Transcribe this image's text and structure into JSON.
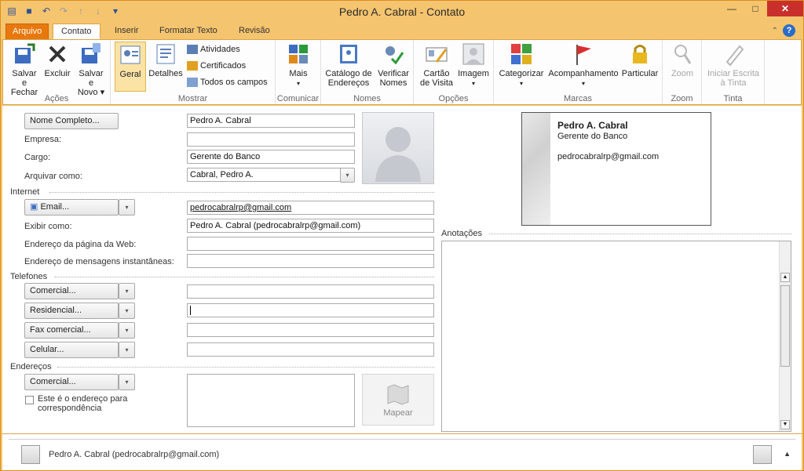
{
  "window": {
    "title": "Pedro A. Cabral  -  Contato"
  },
  "tabs": {
    "file": "Arquivo",
    "contact": "Contato",
    "insert": "Inserir",
    "format": "Formatar Texto",
    "review": "Revisão"
  },
  "ribbon": {
    "acoes": {
      "label": "Ações",
      "save_close": [
        "Salvar e",
        "Fechar"
      ],
      "delete": "Excluir",
      "save_new": [
        "Salvar e",
        "Novo ▾"
      ]
    },
    "mostrar": {
      "label": "Mostrar",
      "general": "Geral",
      "details": "Detalhes",
      "activities": "Atividades",
      "certificates": "Certificados",
      "all_fields": "Todos os campos"
    },
    "comunicar": {
      "label": "Comunicar",
      "more": "Mais"
    },
    "nomes": {
      "label": "Nomes",
      "address_book": [
        "Catálogo de",
        "Endereços"
      ],
      "check_names": [
        "Verificar",
        "Nomes"
      ]
    },
    "opcoes": {
      "label": "Opções",
      "business_card": [
        "Cartão",
        "de Visita"
      ],
      "picture": "Imagem"
    },
    "marcas": {
      "label": "Marcas",
      "categorize": "Categorizar",
      "follow_up": "Acompanhamento",
      "private": "Particular"
    },
    "zoom": {
      "label": "Zoom",
      "zoom": "Zoom"
    },
    "tinta": {
      "label": "Tinta",
      "start_inking": [
        "Iniciar Escrita",
        "à Tinta"
      ]
    }
  },
  "form": {
    "full_name_button": "Nome Completo...",
    "full_name_value": "Pedro A. Cabral",
    "company_label": "Empresa:",
    "company_value": "",
    "job_label": "Cargo:",
    "job_value": "Gerente do Banco",
    "file_as_label": "Arquivar como:",
    "file_as_value": "Cabral, Pedro A.",
    "internet_section": "Internet",
    "email_button": "Email...",
    "email_value": "pedrocabralrp@gmail.com",
    "display_as_label": "Exibir como:",
    "display_as_value": "Pedro A. Cabral (pedrocabralrp@gmail.com)",
    "web_label": "Endereço da página da Web:",
    "web_value": "",
    "im_label": "Endereço de mensagens instantâneas:",
    "im_value": "",
    "phones_section": "Telefones",
    "phone_business": "Comercial...",
    "phone_home": "Residencial...",
    "phone_fax": "Fax comercial...",
    "phone_mobile": "Celular...",
    "addresses_section": "Endereços",
    "address_business": "Comercial...",
    "mailing_check_label": [
      "Este é o endereço para",
      "correspondência"
    ],
    "map_button": "Mapear",
    "notes_label": "Anotações"
  },
  "card": {
    "name": "Pedro A. Cabral",
    "job": "Gerente do Banco",
    "email": "pedrocabralrp@gmail.com"
  },
  "people_pane": {
    "contact": "Pedro A. Cabral (pedrocabralrp@gmail.com)"
  },
  "colors": {
    "accent": "#f5c46e",
    "file_tab": "#e8780c",
    "close": "#c9302c"
  }
}
